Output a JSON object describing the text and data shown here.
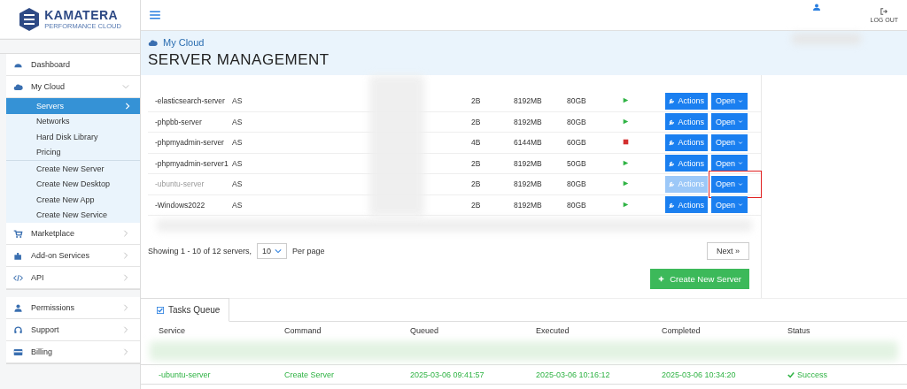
{
  "logo": {
    "name": "KAMATERA",
    "tagline": "PERFORMANCE CLOUD"
  },
  "topbar": {
    "logout": "LOG OUT"
  },
  "sidebar": {
    "groups": [
      [
        {
          "kind": "link",
          "label": "Dashboard"
        },
        {
          "kind": "menu",
          "label": "My Cloud",
          "expanded": true,
          "children": [
            {
              "label": "Servers",
              "selected": true
            },
            {
              "label": "Networks",
              "selected": false
            },
            {
              "label": "Hard Disk Library",
              "selected": false
            },
            {
              "label": "Pricing",
              "selected": false
            }
          ],
          "actions": [
            {
              "label": "Create New Server"
            },
            {
              "label": "Create New Desktop"
            },
            {
              "label": "Create New App"
            },
            {
              "label": "Create New Service"
            }
          ]
        },
        {
          "kind": "menu",
          "label": "Marketplace",
          "expanded": false
        },
        {
          "kind": "menu",
          "label": "Add-on Services",
          "expanded": false
        },
        {
          "kind": "menu",
          "label": "API",
          "expanded": false
        }
      ],
      [
        {
          "kind": "menu",
          "label": "Permissions",
          "expanded": false
        },
        {
          "kind": "menu",
          "label": "Support",
          "expanded": false
        },
        {
          "kind": "menu",
          "label": "Billing",
          "expanded": false
        }
      ]
    ]
  },
  "header": {
    "breadcrumb": "My Cloud",
    "title": "SERVER MANAGEMENT"
  },
  "servers": [
    {
      "name": "-elasticsearch-server",
      "region": "AS",
      "cpu": "2B",
      "ram": "8192MB",
      "disk": "80GB",
      "running": true,
      "disabled": false,
      "highlighted": false,
      "actions": "Actions",
      "open": "Open"
    },
    {
      "name": "-phpbb-server",
      "region": "AS",
      "cpu": "2B",
      "ram": "8192MB",
      "disk": "80GB",
      "running": true,
      "disabled": false,
      "highlighted": false,
      "actions": "Actions",
      "open": "Open"
    },
    {
      "name": "-phpmyadmin-server",
      "region": "AS",
      "cpu": "4B",
      "ram": "6144MB",
      "disk": "60GB",
      "running": false,
      "disabled": false,
      "highlighted": false,
      "actions": "Actions",
      "open": "Open"
    },
    {
      "name": "-phpmyadmin-server1",
      "region": "AS",
      "cpu": "2B",
      "ram": "8192MB",
      "disk": "50GB",
      "running": true,
      "disabled": false,
      "highlighted": false,
      "actions": "Actions",
      "open": "Open"
    },
    {
      "name": "-ubuntu-server",
      "region": "AS",
      "cpu": "2B",
      "ram": "8192MB",
      "disk": "80GB",
      "running": true,
      "disabled": true,
      "highlighted": true,
      "actions": "Actions",
      "open": "Open"
    },
    {
      "name": "-Windows2022",
      "region": "AS",
      "cpu": "2B",
      "ram": "8192MB",
      "disk": "80GB",
      "running": true,
      "disabled": false,
      "highlighted": false,
      "actions": "Actions",
      "open": "Open"
    }
  ],
  "pagination": {
    "summary": "Showing 1 - 10 of 12 servers,",
    "per_page_value": "10",
    "per_page_label": "Per page",
    "next": "Next »"
  },
  "create_button": "Create New Server",
  "tasks": {
    "tab": "Tasks Queue",
    "columns": [
      "Service",
      "Command",
      "Queued",
      "Executed",
      "Completed",
      "Status"
    ],
    "rows": [
      {
        "service": "-ubuntu-server",
        "command": "Create Server",
        "queued": "2025-03-06 09:41:57",
        "executed": "2025-03-06 10:16:12",
        "completed": "2025-03-06 10:34:20",
        "status": "Success",
        "success": true
      }
    ]
  }
}
